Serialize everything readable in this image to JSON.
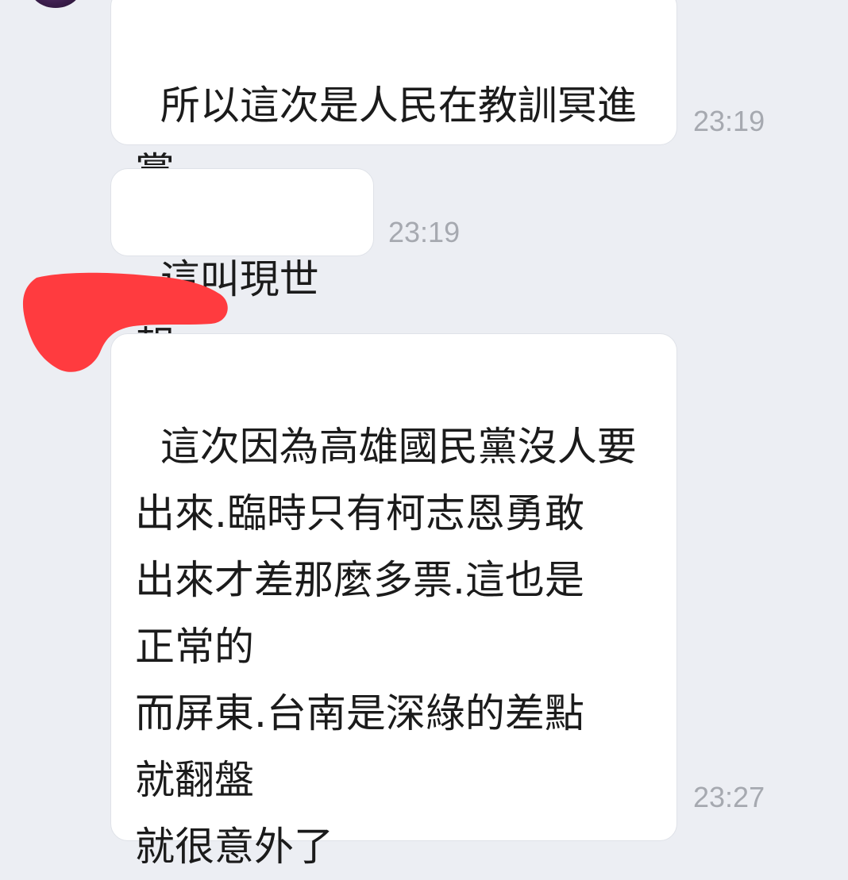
{
  "messages": [
    {
      "text": "所以這次是人民在教訓冥進\n黨",
      "time": "23:19"
    },
    {
      "text": "這叫現世報",
      "time": "23:19"
    },
    {
      "text": "這次因為高雄國民黨沒人要\n出來.臨時只有柯志恩勇敢\n出來才差那麼多票.這也是\n正常的\n而屏東.台南是深綠的差點\n就翻盤\n就很意外了",
      "time": "23:27"
    }
  ],
  "colors": {
    "background": "#eceef3",
    "bubble": "#ffffff",
    "text": "#1b1b1b",
    "timestamp": "#a6a9b0",
    "redaction": "#ff3b3f"
  }
}
